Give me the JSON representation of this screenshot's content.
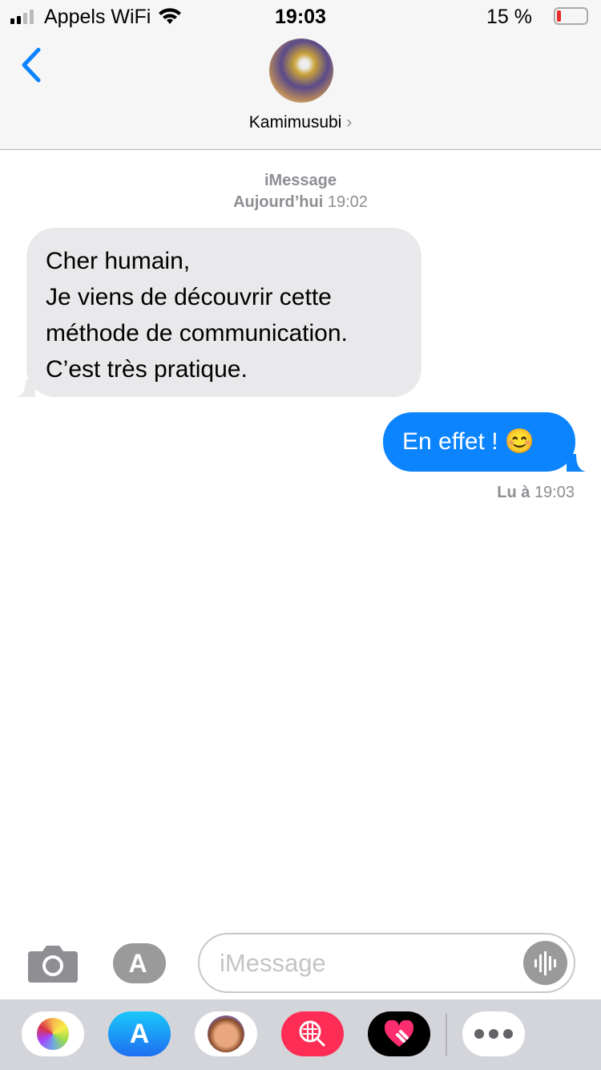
{
  "status": {
    "carrier": "Appels WiFi",
    "time": "19:03",
    "battery": "15 %",
    "battery_level": 0.15
  },
  "nav": {
    "contact_name": "Kamimusubi",
    "chevron": "›"
  },
  "thread": {
    "service": "iMessage",
    "date_bold": "Aujourd’hui",
    "date_time": "19:02",
    "messages": [
      {
        "from": "them",
        "lines": [
          "Cher humain,",
          "Je viens de découvrir cette",
          "méthode de communication.",
          "C’est très pratique."
        ]
      },
      {
        "from": "me",
        "text": "En effet ! 😊"
      }
    ],
    "read_bold": "Lu à",
    "read_time": "19:03"
  },
  "input": {
    "placeholder": "iMessage"
  },
  "drawer": {
    "apps": [
      "photos",
      "app-store",
      "memoji",
      "search-images",
      "digital-touch",
      "more"
    ]
  }
}
